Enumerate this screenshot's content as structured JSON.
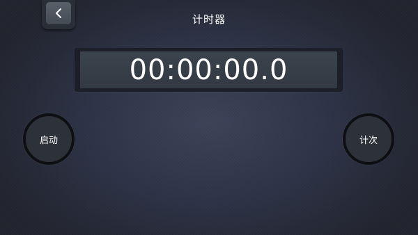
{
  "header": {
    "title": "计时器",
    "back_icon": "chevron-left-icon"
  },
  "timer": {
    "display": "00:00:00.0"
  },
  "controls": {
    "start_label": "启动",
    "lap_label": "计次"
  }
}
